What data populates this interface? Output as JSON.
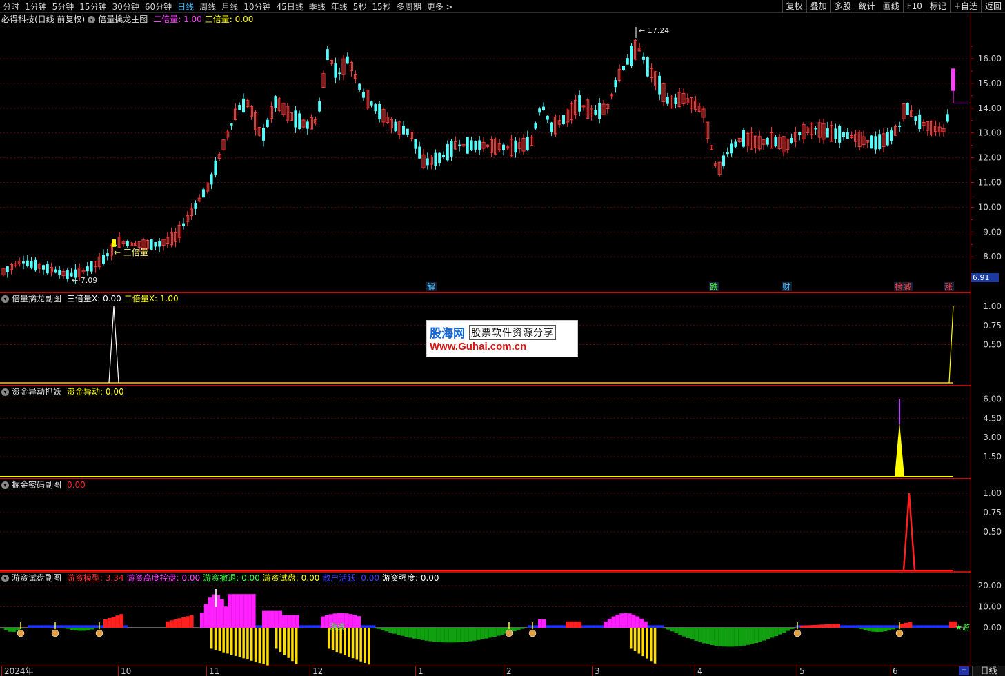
{
  "toolbar": {
    "periods": [
      "分时",
      "1分钟",
      "5分钟",
      "15分钟",
      "30分钟",
      "60分钟",
      "日线",
      "周线",
      "月线",
      "10分钟",
      "45日线",
      "季线",
      "年线",
      "5秒",
      "15秒",
      "多周期",
      "更多 >"
    ],
    "active_period": "日线",
    "right_buttons": [
      "复权",
      "叠加",
      "多股",
      "统计",
      "画线",
      "F10",
      "标记",
      "+自选",
      "返回"
    ]
  },
  "main_panel": {
    "stock_title": "必得科技(日线 前复权)",
    "indicator_name": "倍量擒龙主图",
    "vars": [
      {
        "label": "二倍量:",
        "value": "1.00",
        "color": "#ff40ff"
      },
      {
        "label": "三倍量:",
        "value": "0.00",
        "color": "#ffff00"
      }
    ],
    "price_axis": [
      "16.00",
      "15.00",
      "14.00",
      "13.00",
      "12.00",
      "11.00",
      "10.00",
      "9.00",
      "8.00"
    ],
    "last_price_box": "6.91",
    "high_label": "17.24",
    "low_label": "7.09",
    "signal_label": "三倍量",
    "event_markers": [
      {
        "text": "解",
        "color": "#40c0ff"
      },
      {
        "text": "跌",
        "color": "#40ff40"
      },
      {
        "text": "财",
        "color": "#40c0ff"
      },
      {
        "text": "榜减",
        "color": "#ff4040"
      },
      {
        "text": "涨",
        "color": "#ff4040"
      }
    ]
  },
  "panel2": {
    "name": "倍量擒龙副图",
    "vars": [
      {
        "label": "三倍量X:",
        "value": "0.00",
        "color": "#ffffff"
      },
      {
        "label": "二倍量X:",
        "value": "1.00",
        "color": "#ffff00"
      }
    ],
    "axis": [
      "1.00",
      "0.75",
      "0.50"
    ]
  },
  "panel3": {
    "name": "资金异动抓妖",
    "vars": [
      {
        "label": "资金异动:",
        "value": "0.00",
        "color": "#ffff00"
      }
    ],
    "axis": [
      "6.00",
      "4.50",
      "3.00",
      "1.50"
    ]
  },
  "panel4": {
    "name": "掘金密码副图",
    "vars": [
      {
        "label": "",
        "value": "0.00",
        "color": "#ff2020"
      }
    ],
    "axis": [
      "1.00",
      "0.75",
      "0.50"
    ]
  },
  "panel5": {
    "name": "游资试盘副图",
    "vars": [
      {
        "label": "游资模型:",
        "value": "3.34",
        "color": "#ff3030"
      },
      {
        "label": "游资高度控盘:",
        "value": "0.00",
        "color": "#ff40ff"
      },
      {
        "label": "游资撤退:",
        "value": "0.00",
        "color": "#40ff40"
      },
      {
        "label": "游资试盘:",
        "value": "0.00",
        "color": "#ffff00"
      },
      {
        "label": "散户活跃:",
        "value": "0.00",
        "color": "#4040ff"
      },
      {
        "label": "游资强度:",
        "value": "0.00",
        "color": "#ffffff"
      }
    ],
    "axis": [
      "20.00",
      "10.00",
      "0.00"
    ],
    "labels": [
      "游资",
      "★游"
    ]
  },
  "time_axis": [
    "2024年",
    "10",
    "11",
    "12",
    "1",
    "2",
    "3",
    "4",
    "5",
    "6"
  ],
  "bottom_tab": "日线",
  "bottom_arrow": "--",
  "watermark": {
    "brand": "股海网",
    "slogan": "股票软件资源分享",
    "url": "Www.Guhai.com.cn"
  }
}
